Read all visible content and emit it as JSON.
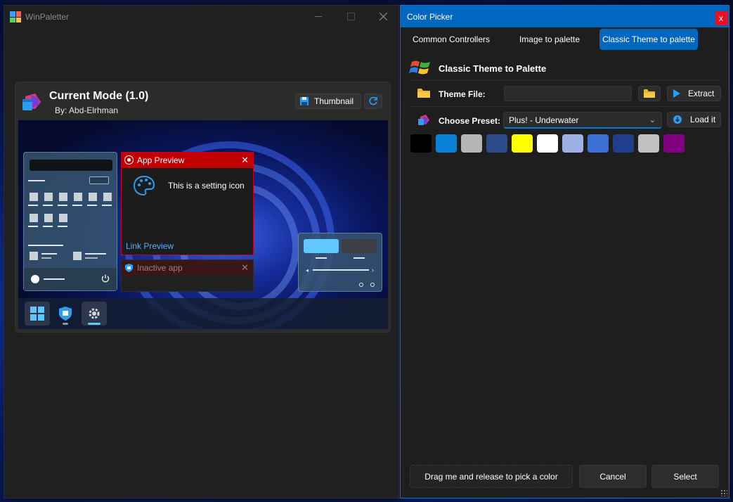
{
  "left_window": {
    "title": "WinPaletter",
    "theme_card": {
      "title": "Current Mode (1.0)",
      "author": "By: Abd-Elrhman",
      "thumbnail_label": "Thumbnail"
    },
    "preview": {
      "app_preview_title": "App Preview",
      "setting_text": "This is a setting icon",
      "link_text": "Link Preview",
      "inactive_title": "Inactive app"
    }
  },
  "right_window": {
    "title": "Color Picker",
    "close_label": "x",
    "tabs": [
      {
        "label": "Common Controllers"
      },
      {
        "label": "Image to palette"
      },
      {
        "label": "Classic Theme to palette"
      }
    ],
    "section_title": "Classic Theme to Palette",
    "theme_file_label": "Theme File:",
    "theme_file_value": "",
    "extract_label": "Extract",
    "preset_label": "Choose Preset:",
    "preset_value": "Plus! - Underwater",
    "load_label": "Load it",
    "swatches": [
      "#000000",
      "#0a82d8",
      "#b4b4b4",
      "#2a4a88",
      "#ffff00",
      "#ffffff",
      "#9db0e6",
      "#3b6fd4",
      "#213e8c",
      "#c0c0c0",
      "#800080"
    ],
    "drag_label": "Drag me and release to pick a color",
    "cancel_label": "Cancel",
    "select_label": "Select"
  }
}
